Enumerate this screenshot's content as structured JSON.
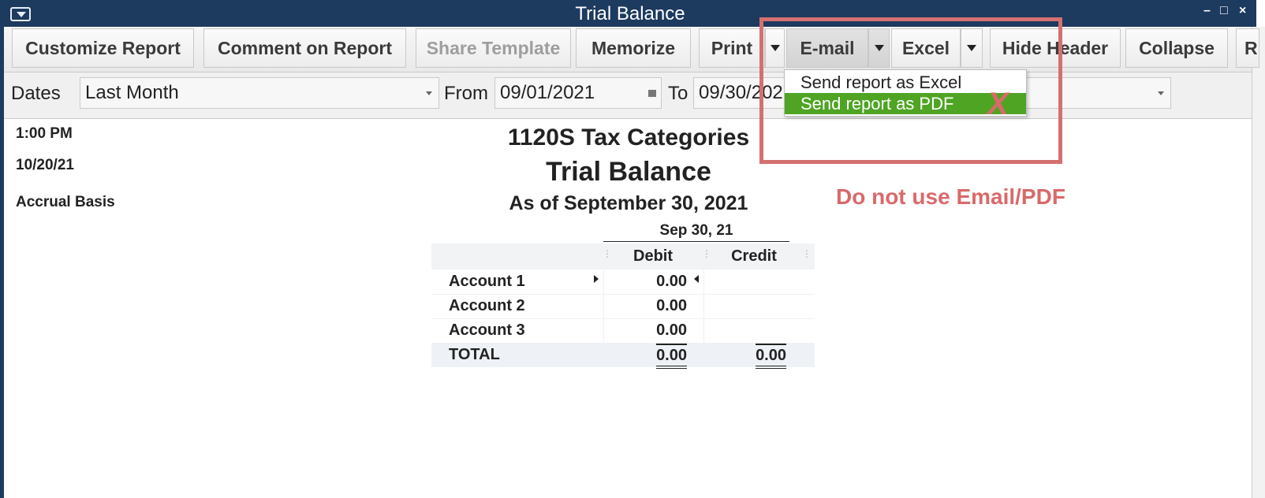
{
  "window": {
    "title": "Trial Balance",
    "controls": {
      "minimize": "–",
      "restore": "□",
      "close": "×"
    }
  },
  "toolbar": {
    "customize": "Customize Report",
    "comment": "Comment on Report",
    "share_template": "Share Template",
    "memorize": "Memorize",
    "print": "Print",
    "email": "E-mail",
    "excel": "Excel",
    "hide_header": "Hide Header",
    "collapse": "Collapse",
    "refresh_partial": "R"
  },
  "filters": {
    "dates_label": "Dates",
    "dates_value": "Last Month",
    "from_label": "From",
    "from_value": "09/01/2021",
    "to_label": "To",
    "to_value": "09/30/2021"
  },
  "email_menu": {
    "items": [
      "Send report as Excel",
      "Send report as PDF"
    ],
    "selected_index": 1
  },
  "annotation": {
    "warning": "Do not use Email/PDF",
    "x_mark": "X",
    "color": "#d47070"
  },
  "report": {
    "time": "1:00 PM",
    "date": "10/20/21",
    "basis": "Accrual Basis",
    "company": "1120S Tax Categories",
    "title": "Trial Balance",
    "subtitle": "As of September 30, 2021",
    "period_header": "Sep 30, 21",
    "col_debit": "Debit",
    "col_credit": "Credit",
    "rows": [
      {
        "account": "Account 1",
        "debit": "0.00",
        "credit": ""
      },
      {
        "account": "Account 2",
        "debit": "0.00",
        "credit": ""
      },
      {
        "account": "Account 3",
        "debit": "0.00",
        "credit": ""
      }
    ],
    "total": {
      "label": "TOTAL",
      "debit": "0.00",
      "credit": "0.00"
    }
  },
  "colors": {
    "titlebar": "#1d3a5f",
    "menu_selected": "#4fa424",
    "annotation": "#d47070"
  }
}
